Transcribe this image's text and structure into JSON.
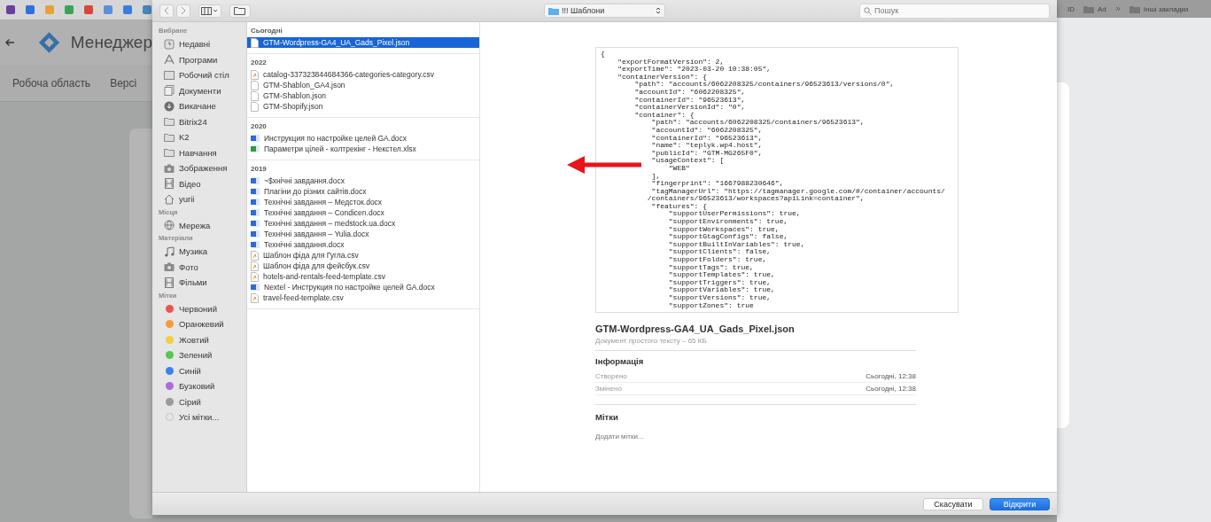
{
  "background_page": {
    "title": "Менеджер",
    "tabs": [
      {
        "label": "Робоча область"
      },
      {
        "label": "Версі"
      }
    ]
  },
  "bookmarks_right": [
    "ID",
    "Ad",
    "Інші закладки"
  ],
  "dialog": {
    "location": "!!! Шаблони",
    "search": {
      "placeholder": "Пошук"
    },
    "sidebar": [
      {
        "heading": "Вибране",
        "items": [
          {
            "label": "Недавні",
            "kind": "recent"
          },
          {
            "label": "Програми",
            "kind": "apps"
          },
          {
            "label": "Робочий стіл",
            "kind": "desktop"
          },
          {
            "label": "Документи",
            "kind": "documents"
          },
          {
            "label": "Викачане",
            "kind": "downloads"
          },
          {
            "label": "Bitrix24",
            "kind": "folder"
          },
          {
            "label": "K2",
            "kind": "folder"
          },
          {
            "label": "Навчання",
            "kind": "folder"
          },
          {
            "label": "Зображення",
            "kind": "camera"
          },
          {
            "label": "Відео",
            "kind": "film"
          },
          {
            "label": "yurii",
            "kind": "home"
          }
        ]
      },
      {
        "heading": "Місця",
        "items": [
          {
            "label": "Мережа",
            "kind": "globe"
          }
        ]
      },
      {
        "heading": "Матеріали",
        "items": [
          {
            "label": "Музика",
            "kind": "music"
          },
          {
            "label": "Фото",
            "kind": "camera"
          },
          {
            "label": "Фільми",
            "kind": "film"
          }
        ]
      },
      {
        "heading": "Мітки",
        "items": [
          {
            "label": "Червоний",
            "kind": "tag",
            "color": "#f0524c"
          },
          {
            "label": "Оранжевий",
            "kind": "tag",
            "color": "#f59a3c"
          },
          {
            "label": "Жовтий",
            "kind": "tag",
            "color": "#f5cc42"
          },
          {
            "label": "Зелений",
            "kind": "tag",
            "color": "#57c653"
          },
          {
            "label": "Синій",
            "kind": "tag",
            "color": "#3b82f0"
          },
          {
            "label": "Бузковий",
            "kind": "tag",
            "color": "#b06ad6"
          },
          {
            "label": "Сірий",
            "kind": "tag",
            "color": "#9a9a9a"
          },
          {
            "label": "Усі мітки...",
            "kind": "all-tags"
          }
        ]
      }
    ],
    "file_groups": [
      {
        "heading": "Сьогодні",
        "files": [
          {
            "name": "GTM-Wordpress-GA4_UA_Gads_Pixel.json",
            "kind": "json",
            "selected": true
          }
        ]
      },
      {
        "heading": "2022",
        "files": [
          {
            "name": "catalog-337323844684366-categories-category.csv",
            "kind": "csv",
            "selected": false
          },
          {
            "name": "GTM-Shablon_GA4.json",
            "kind": "json",
            "selected": false
          },
          {
            "name": "GTM-Shablon.json",
            "kind": "json",
            "selected": false
          },
          {
            "name": "GTM-Shopify.json",
            "kind": "json",
            "selected": false
          }
        ]
      },
      {
        "heading": "2020",
        "files": [
          {
            "name": "Инструкция по настройке целей GA.docx",
            "kind": "docx",
            "selected": false
          },
          {
            "name": "Параметри цілей - колтрекінг - Некстел.xlsx",
            "kind": "xlsx",
            "selected": false
          }
        ]
      },
      {
        "heading": "2019",
        "files": [
          {
            "name": "~$хнічні завдання.docx",
            "kind": "docx",
            "selected": false
          },
          {
            "name": "Плагіни до різних сайтів.docx",
            "kind": "docx",
            "selected": false
          },
          {
            "name": "Технічні завдання – Медсток.docx",
            "kind": "docx",
            "selected": false
          },
          {
            "name": "Технічні завдання – Condicen.docx",
            "kind": "docx",
            "selected": false
          },
          {
            "name": "Технічні завдання – medstock.ua.docx",
            "kind": "docx",
            "selected": false
          },
          {
            "name": "Технічні завдання – Yulia.docx",
            "kind": "docx",
            "selected": false
          },
          {
            "name": "Технічні завдання.docx",
            "kind": "docx",
            "selected": false
          },
          {
            "name": "Шаблон фіда для Гугла.csv",
            "kind": "csv",
            "selected": false
          },
          {
            "name": "Шаблон фіда для фейсбук.csv",
            "kind": "csv",
            "selected": false
          },
          {
            "name": "hotels-and-rentals-feed-template.csv",
            "kind": "csv",
            "selected": false
          },
          {
            "name": "Nextel - Инструкция по настройке целей GA.docx",
            "kind": "docx",
            "selected": false
          },
          {
            "name": "travel-feed-template.csv",
            "kind": "csv",
            "selected": false
          }
        ]
      }
    ],
    "preview_lines": [
      "{",
      "    \"exportFormatVersion\": 2,",
      "    \"exportTime\": \"2023-03-20 10:38:05\",",
      "    \"containerVersion\": {",
      "        \"path\": \"accounts/6062208325/containers/96523613/versions/0\",",
      "        \"accountId\": \"6062208325\",",
      "        \"containerId\": \"96523613\",",
      "        \"containerVersionId\": \"0\",",
      "        \"container\": {",
      "            \"path\": \"accounts/6062208325/containers/96523613\",",
      "            \"accountId\": \"6062208325\",",
      "            \"containerId\": \"96523613\",",
      "            \"name\": \"teplyk.wp4.host\",",
      "            \"publicId\": \"GTM-MG265F0\",",
      "            \"usageContext\": [",
      "                \"WEB\"",
      "            ],",
      "            \"fingerprint\": \"1667988230646\",",
      "            \"tagManagerUrl\": \"https://tagmanager.google.com/#/container/accounts/",
      "           /containers/96523613/workspaces?apiLink=container\",",
      "            \"features\": {",
      "                \"supportUserPermissions\": true,",
      "                \"supportEnvironments\": true,",
      "                \"supportWorkspaces\": true,",
      "                \"supportGtagConfigs\": false,",
      "                \"supportBuiltInVariables\": true,",
      "                \"supportClients\": false,",
      "                \"supportFolders\": true,",
      "                \"supportTags\": true,",
      "                \"supportTemplates\": true,",
      "                \"supportTriggers\": true,",
      "                \"supportVariables\": true,",
      "                \"supportVersions\": true,",
      "                \"supportZones\": true"
    ],
    "info": {
      "file_name": "GTM-Wordpress-GA4_UA_Gads_Pixel.json",
      "subtitle": "Документ простого тексту – 65 КБ",
      "heading": "Інформація",
      "rows": [
        {
          "label": "Створено",
          "value": "Сьогодні, 12:38"
        },
        {
          "label": "Змінено",
          "value": "Сьогодні, 12:38"
        }
      ],
      "tags_heading": "Мітки",
      "tags_placeholder": "Додати мітки..."
    },
    "buttons": [
      {
        "label": "Скасувати",
        "kind": "cancel"
      },
      {
        "label": "Відкрити",
        "kind": "primary"
      }
    ]
  }
}
